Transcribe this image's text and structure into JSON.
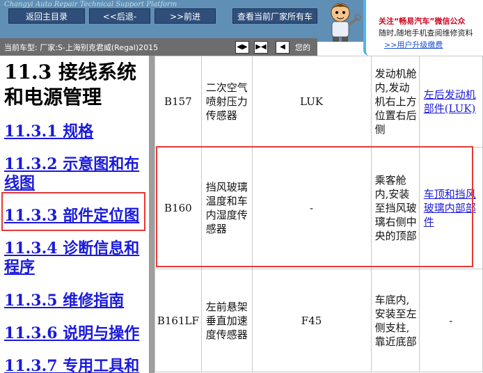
{
  "header": {
    "brand": "Changyi Auto Repair Technical Support Platform",
    "nav": [
      "返回主目录",
      "<<后退-",
      ">>前进",
      "查看当前厂家所有车"
    ],
    "promo_line1": "关注“畅易汽车”微信公众",
    "promo_line2": "随时,随地手机查阅维修资料",
    "promo_link": ">>用户升级缴费"
  },
  "car_bar": {
    "label": "当前车型:   厂家:S-上海别克君威(Regal)2015",
    "controls": [
      "◀▶",
      "▶◀",
      "◀"
    ],
    "right_text": "您的"
  },
  "toc": {
    "title": "11.3 接线系统和电源管理",
    "items": [
      "11.3.1 规格",
      "11.3.2 示意图和布线图",
      "11.3.3 部件定位图",
      "11.3.4 诊断信息和程序",
      "11.3.5 维修指南",
      "11.3.6 说明与操作",
      "11.3.7 专用工具和"
    ]
  },
  "table": {
    "rows": [
      {
        "code": "B157",
        "name": "二次空气喷射压力传感器",
        "supplier": "LUK",
        "location": "发动机舱内,发动机右上方位置右后侧",
        "link": "左后发动机部件(LUK)"
      },
      {
        "code": "B160",
        "name": "挡风玻璃温度和车内湿度传感器",
        "supplier": "-",
        "location": "乘客舱内,安装至挡风玻璃右侧中央的顶部",
        "link": "车顶和挡风玻璃内部部件"
      },
      {
        "code": "B161LF",
        "name": "左前悬架垂直加速度传感器",
        "supplier": "F45",
        "location": "车底内,安装至左侧支柱,靠近底部",
        "link": "-"
      }
    ]
  },
  "colors": {
    "highlight": "#e53935",
    "link": "#1a1adc",
    "topbar": "#5f8fb5"
  }
}
